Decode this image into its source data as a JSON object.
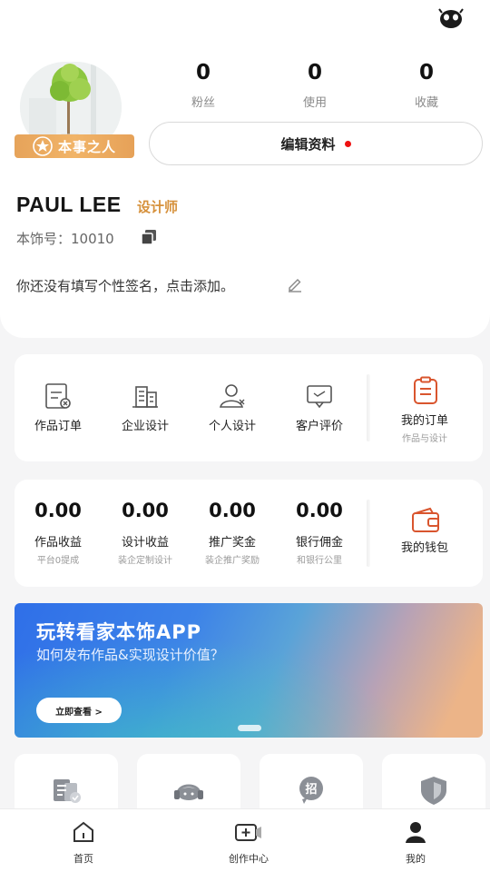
{
  "profile": {
    "badge": "本事之人",
    "name": "PAUL LEE",
    "role": "设计师",
    "id_line": "本饰号：10010",
    "bio": "你还没有填写个性签名，点击添加。",
    "edit_label": "编辑资料",
    "stats": [
      {
        "value": "0",
        "label": "粉丝"
      },
      {
        "value": "0",
        "label": "使用"
      },
      {
        "value": "0",
        "label": "收藏"
      }
    ]
  },
  "services": {
    "items": [
      {
        "label": "作品订单",
        "icon": "order-doc-icon"
      },
      {
        "label": "企业设计",
        "icon": "building-icon"
      },
      {
        "label": "个人设计",
        "icon": "person-icon"
      },
      {
        "label": "客户评价",
        "icon": "comment-icon"
      }
    ],
    "side": {
      "label": "我的订单",
      "sub": "作品与设计",
      "icon": "clipboard-icon"
    }
  },
  "earnings": {
    "items": [
      {
        "value": "0.00",
        "label": "作品收益",
        "sub": "平台0提成"
      },
      {
        "value": "0.00",
        "label": "设计收益",
        "sub": "装企定制设计"
      },
      {
        "value": "0.00",
        "label": "推广奖金",
        "sub": "装企推广奖励"
      },
      {
        "value": "0.00",
        "label": "银行佣金",
        "sub": "和银行公里"
      }
    ],
    "side": {
      "label": "我的钱包",
      "icon": "wallet-icon"
    }
  },
  "banner": {
    "title": "玩转看家本饰APP",
    "subtitle": "如何发布作品&实现设计价值？",
    "button": "立即查看 >"
  },
  "tiles": [
    {
      "icon": "document-check-icon"
    },
    {
      "icon": "headset-icon"
    },
    {
      "icon": "recruit-icon"
    },
    {
      "icon": "shield-icon"
    }
  ],
  "tabbar": [
    {
      "label": "首页",
      "icon": "home-icon"
    },
    {
      "label": "创作中心",
      "icon": "create-icon"
    },
    {
      "label": "我的",
      "icon": "profile-icon"
    }
  ],
  "colors": {
    "accent": "#d6913c",
    "badge": "#eea95f",
    "red_dot": "#e11111",
    "orange_icon": "#d9552e"
  }
}
